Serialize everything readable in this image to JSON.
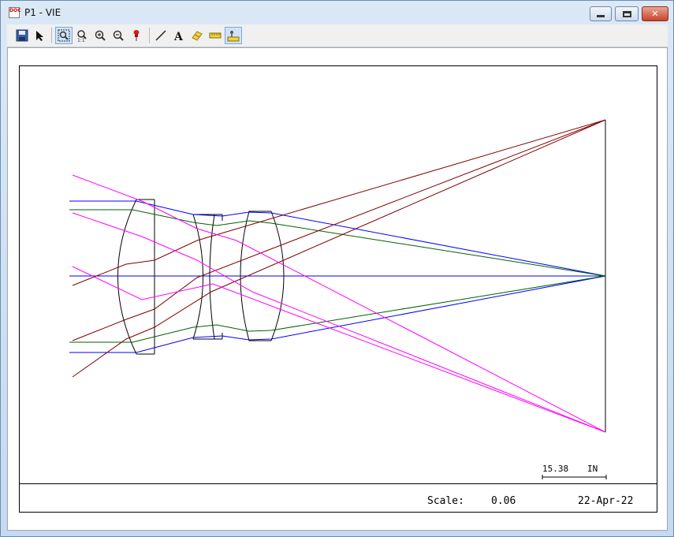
{
  "window": {
    "title": "P1 - VIE",
    "app_icon_text": "DOC"
  },
  "toolbar": {
    "buttons": [
      {
        "name": "save-icon",
        "label": "Save"
      },
      {
        "name": "pointer-icon",
        "label": "Select"
      },
      {
        "name": "zoom-window-icon",
        "label": "Zoom window",
        "active": true
      },
      {
        "name": "zoom-1to1-icon",
        "label": "Zoom 1:1"
      },
      {
        "name": "zoom-in-icon",
        "label": "Zoom in"
      },
      {
        "name": "zoom-out-icon",
        "label": "Zoom out"
      },
      {
        "name": "pin-icon",
        "label": "Pin"
      },
      {
        "name": "line-icon",
        "label": "Line"
      },
      {
        "name": "text-icon",
        "label": "Text"
      },
      {
        "name": "eraser-icon",
        "label": "Eraser"
      },
      {
        "name": "ruler-icon",
        "label": "Ruler"
      },
      {
        "name": "measure-icon",
        "label": "Measure",
        "active": true
      }
    ]
  },
  "plot": {
    "scale_bar_value": "15.38",
    "scale_bar_unit": "IN",
    "scale_label": "Scale:",
    "scale_value": "0.06",
    "date": "22-Apr-22"
  },
  "colors": {
    "axis_ray": "#0000ff",
    "field_ray": "#ff00ff",
    "mid_field_ray": "#006000",
    "chief_ray": "#800000",
    "lens": "#000000"
  }
}
